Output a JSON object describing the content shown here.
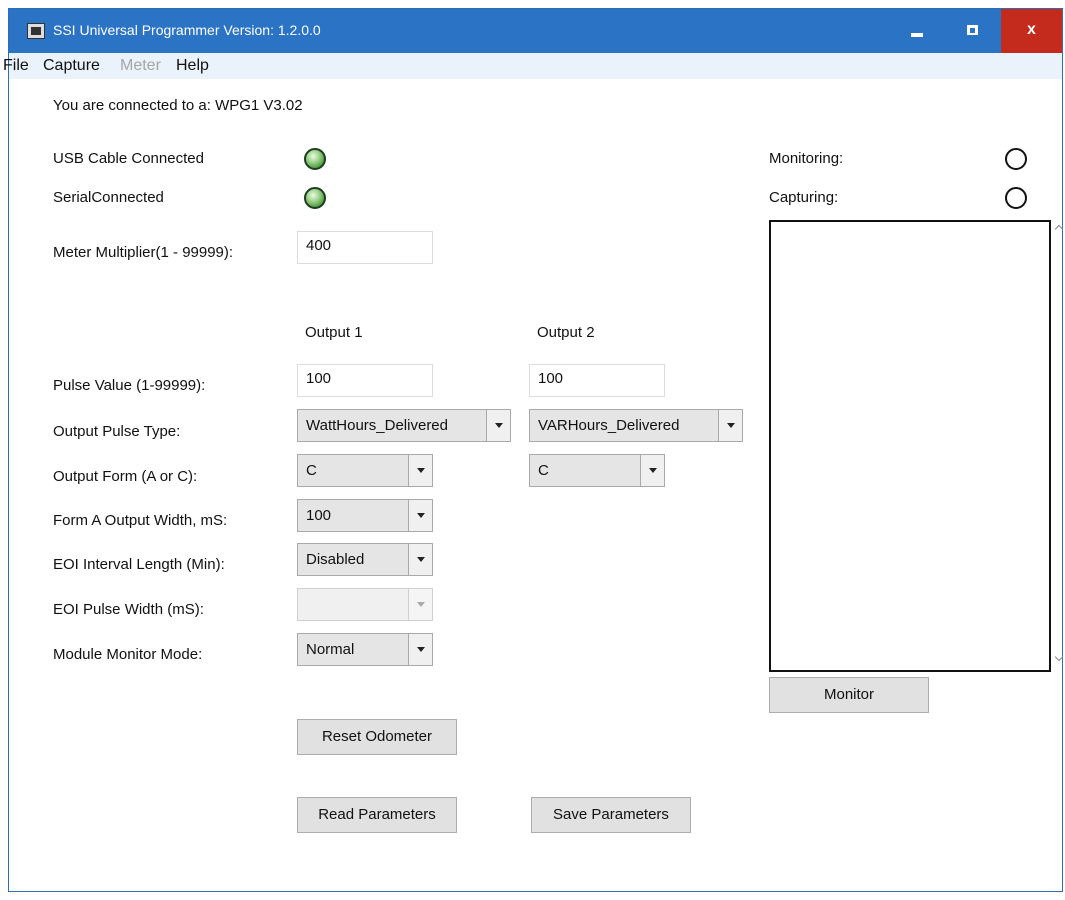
{
  "window": {
    "title": "SSI Universal Programmer Version: 1.2.0.0",
    "close_glyph": "x"
  },
  "menu": {
    "file": "File",
    "capture": "Capture",
    "meter": "Meter",
    "help": "Help"
  },
  "status": {
    "connected_to": "You are connected to a:  WPG1 V3.02",
    "usb_label": "USB Cable Connected",
    "serial_label": "SerialConnected",
    "monitoring_label": "Monitoring:",
    "capturing_label": "Capturing:"
  },
  "meter_multiplier": {
    "label": "Meter Multiplier(1 - 99999):",
    "value": "400"
  },
  "columns": {
    "output1": "Output 1",
    "output2": "Output 2"
  },
  "fields": {
    "pulse_value_label": "Pulse Value (1-99999):",
    "pulse_value_1": "100",
    "pulse_value_2": "100",
    "pulse_type_label": "Output Pulse Type:",
    "pulse_type_1": "WattHours_Delivered",
    "pulse_type_2": "VARHours_Delivered",
    "output_form_label": "Output Form (A or C):",
    "output_form_1": "C",
    "output_form_2": "C",
    "form_a_width_label": "Form A Output Width, mS:",
    "form_a_width": "100",
    "eoi_interval_label": "EOI Interval Length (Min):",
    "eoi_interval": "Disabled",
    "eoi_pulse_width_label": "EOI Pulse Width (mS):",
    "eoi_pulse_width": "",
    "monitor_mode_label": "Module Monitor Mode:",
    "monitor_mode": "Normal"
  },
  "buttons": {
    "monitor": "Monitor",
    "reset_odometer": "Reset Odometer",
    "read_parameters": "Read Parameters",
    "save_parameters": "Save Parameters"
  },
  "colors": {
    "titlebar": "#2b73c4",
    "close": "#c42b1c",
    "menubar": "#eaf2fb",
    "led_green": "#4d9a3c"
  }
}
